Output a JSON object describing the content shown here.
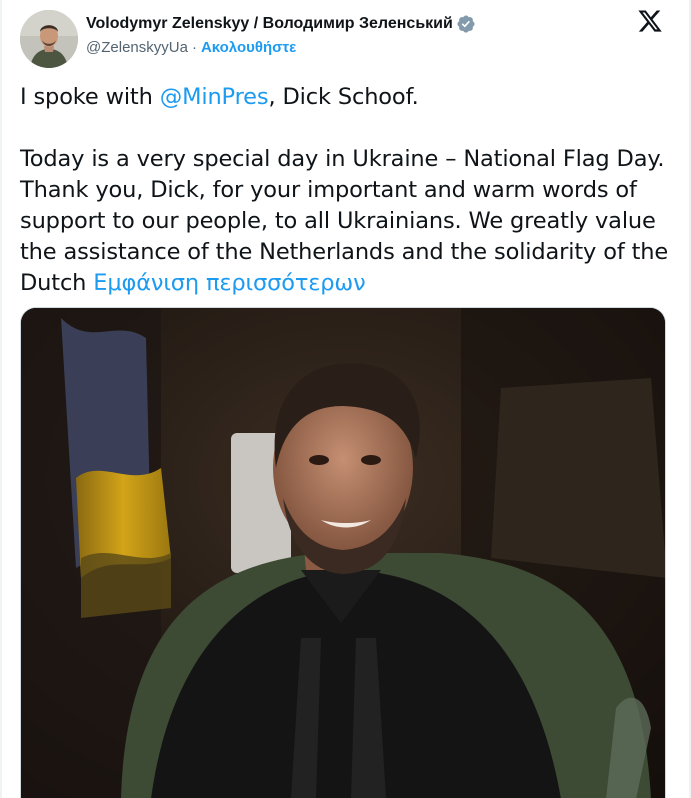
{
  "author": {
    "display_name": "Volodymyr Zelenskyy / Володимир Зеленський",
    "handle": "@ZelenskyyUa",
    "separator": "·",
    "follow_label": "Ακολουθήστε",
    "verified_icon": "verified-badge-icon",
    "colors": {
      "verified": "#1d9bf0",
      "link": "#1d9bf0"
    }
  },
  "platform_icon": "x-logo-icon",
  "tweet": {
    "line1_before": "I spoke with ",
    "mention": "@MinPres",
    "line1_after": ", Dick Schoof.",
    "paragraph2_line1": "Today is a very special day in Ukraine – National Flag Day.",
    "paragraph2_line2": "Thank you, Dick, for your important and warm words of",
    "paragraph2_line3": "support to our people, to all Ukrainians. We greatly value",
    "paragraph2_line4": "the assistance of the Netherlands and the solidarity of the",
    "paragraph2_line5_start": "Dutch ",
    "show_more": "Εμφάνιση περισσότερων"
  }
}
